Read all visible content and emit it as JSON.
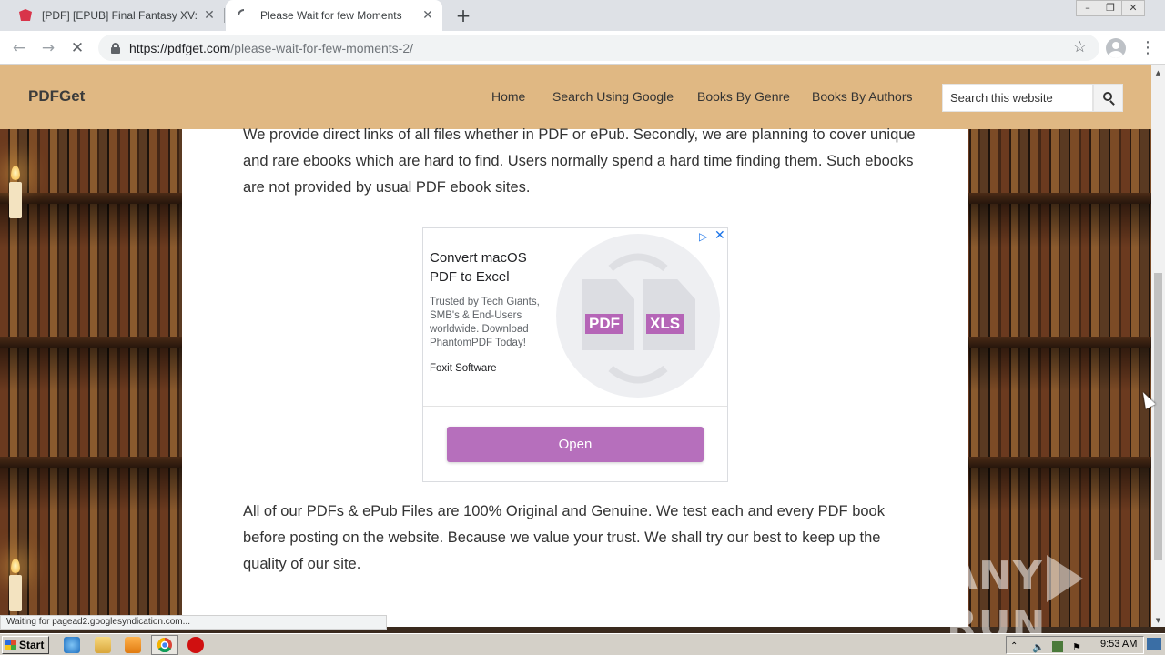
{
  "browser": {
    "tabs": [
      {
        "title": "[PDF] [EPUB] Final Fantasy XV: The Dawn",
        "active": false,
        "icon": "pdf-favicon-icon"
      },
      {
        "title": "Please Wait for few Moments",
        "active": true,
        "icon": "loading-spinner-icon"
      }
    ],
    "url_domain": "https://pdfget.com",
    "url_path": "/please-wait-for-few-moments-2/",
    "status_text": "Waiting for pagead2.googlesyndication.com..."
  },
  "site": {
    "logo": "PDFGet",
    "nav": [
      "Home",
      "Search Using Google",
      "Books By Genre",
      "Books By Authors"
    ],
    "search_placeholder": "Search this website",
    "header_color": "#e0b883"
  },
  "content": {
    "para1": "We provide direct links of all files whether in PDF or ePub. Secondly, we are planning to cover unique and rare ebooks which are hard to find. Users normally spend a hard time finding them. Such ebooks are not provided by usual PDF ebook sites.",
    "para2": "All of our PDFs & ePub Files are 100% Original and Genuine. We test each and every PDF book before posting on the website. Because we value your trust. We shall try our best to keep up the quality of our site."
  },
  "ad": {
    "title": "Convert macOS PDF to Excel",
    "description": "Trusted by Tech Giants, SMB's & End-Users worldwide. Download PhantomPDF Today!",
    "brand": "Foxit Software",
    "doc_left": "PDF",
    "doc_right": "XLS",
    "button": "Open",
    "button_color": "#b66fbc"
  },
  "watermark": {
    "left": "ANY",
    "right": "RUN"
  },
  "taskbar": {
    "start": "Start",
    "clock": "9:53 AM"
  }
}
